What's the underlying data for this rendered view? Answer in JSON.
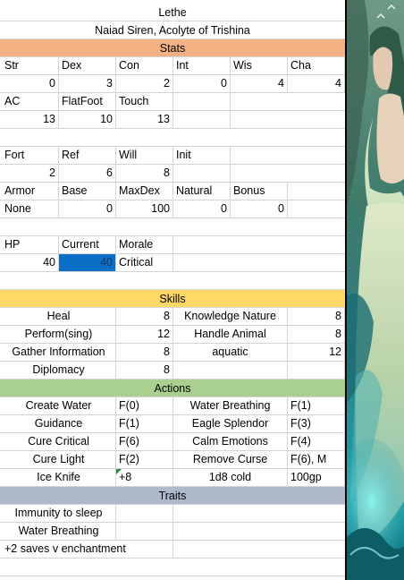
{
  "header": {
    "name": "Lethe",
    "subtitle": "Naiad Siren, Acolyte of Trishina"
  },
  "colors": {
    "stats_band": "#f4b183",
    "skills_band": "#ffd966",
    "actions_band": "#a9d08e",
    "traits_band": "#acb9ca",
    "selected_cell": "#0b6fc7"
  },
  "stats": {
    "title": "Stats",
    "ability_labels": [
      "Str",
      "Dex",
      "Con",
      "Int",
      "Wis",
      "Cha"
    ],
    "ability_values": [
      "0",
      "3",
      "2",
      "0",
      "4",
      "4"
    ],
    "defense_labels": [
      "AC",
      "FlatFoot",
      "Touch"
    ],
    "defense_values": [
      "13",
      "10",
      "13"
    ],
    "save_labels": [
      "Fort",
      "Ref",
      "Will",
      "Init"
    ],
    "save_values": [
      "2",
      "6",
      "8"
    ],
    "armor_labels": [
      "Armor",
      "Base",
      "MaxDex",
      "Natural",
      "Bonus"
    ],
    "armor_values": [
      "None",
      "0",
      "100",
      "0",
      "0"
    ],
    "hp_labels": [
      "HP",
      "Current",
      "Morale"
    ],
    "hp_max": "40",
    "hp_current": "40",
    "morale": "Critical"
  },
  "skills": {
    "title": "Skills",
    "rows": [
      [
        "Heal",
        "8",
        "Knowledge Nature",
        "8"
      ],
      [
        "Perform(sing)",
        "12",
        "Handle Animal",
        "8"
      ],
      [
        "Gather Information",
        "8",
        "aquatic",
        "12"
      ],
      [
        "Diplomacy",
        "8",
        "",
        ""
      ]
    ]
  },
  "actions": {
    "title": "Actions",
    "rows": [
      [
        "Create Water",
        "F(0)",
        "Water Breathing",
        "F(1)"
      ],
      [
        "Guidance",
        "F(1)",
        "Eagle Splendor",
        "F(3)"
      ],
      [
        "Cure Critical",
        "F(6)",
        "Calm Emotions",
        "F(4)"
      ],
      [
        "Cure Light",
        "F(2)",
        "Remove Curse",
        "F(6), M"
      ],
      [
        "Ice Knife",
        "+8",
        "1d8 cold",
        "100gp"
      ]
    ]
  },
  "traits": {
    "title": "Traits",
    "items": [
      "Immunity to sleep",
      "Water Breathing",
      "+2 saves v enchantment"
    ]
  }
}
